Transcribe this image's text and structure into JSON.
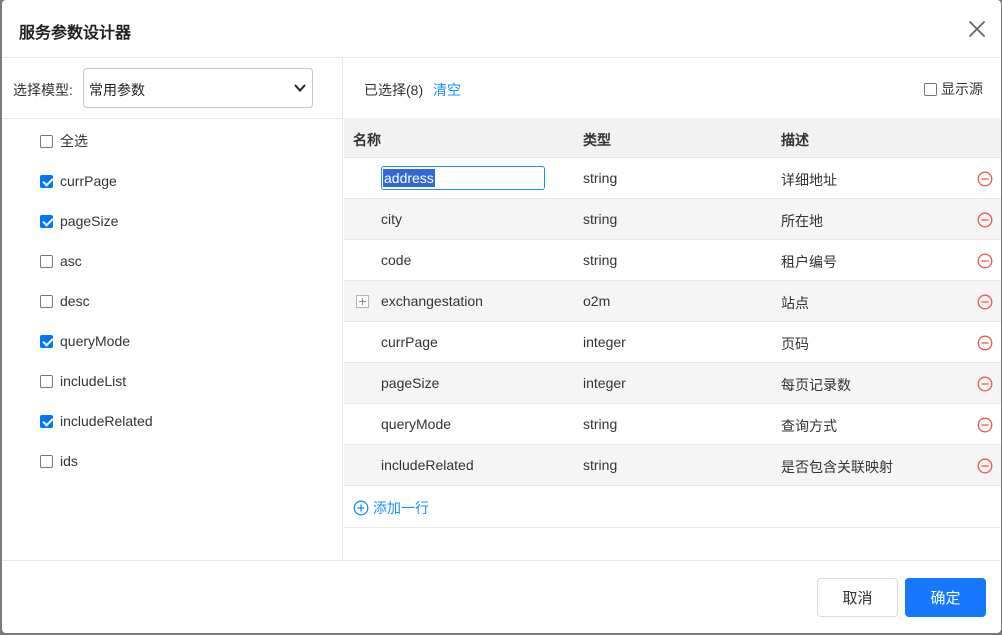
{
  "dialog": {
    "title": "服务参数设计器"
  },
  "left": {
    "model_label": "选择模型:",
    "model_value": "常用参数",
    "checkboxes": [
      {
        "label": "全选",
        "checked": false
      },
      {
        "label": "currPage",
        "checked": true
      },
      {
        "label": "pageSize",
        "checked": true
      },
      {
        "label": "asc",
        "checked": false
      },
      {
        "label": "desc",
        "checked": false
      },
      {
        "label": "queryMode",
        "checked": true
      },
      {
        "label": "includeList",
        "checked": false
      },
      {
        "label": "includeRelated",
        "checked": true
      },
      {
        "label": "ids",
        "checked": false
      }
    ]
  },
  "right": {
    "selected_text": "已选择(8)",
    "clear_label": "清空",
    "show_source_label": "显示源",
    "show_source_checked": false,
    "columns": [
      "名称",
      "类型",
      "描述"
    ],
    "rows": [
      {
        "name": "address",
        "type": "string",
        "desc": "详细地址"
      },
      {
        "name": "city",
        "type": "string",
        "desc": "所在地"
      },
      {
        "name": "code",
        "type": "string",
        "desc": "租户编号"
      },
      {
        "name": "exchangestation",
        "type": "o2m",
        "desc": "站点"
      },
      {
        "name": "currPage",
        "type": "integer",
        "desc": "页码"
      },
      {
        "name": "pageSize",
        "type": "integer",
        "desc": "每页记录数"
      },
      {
        "name": "queryMode",
        "type": "string",
        "desc": "查询方式"
      },
      {
        "name": "includeRelated",
        "type": "string",
        "desc": "是否包含关联映射"
      }
    ],
    "add_row_label": "添加一行"
  },
  "footer": {
    "cancel_label": "取消",
    "ok_label": "确定"
  },
  "colors": {
    "primary": "#1677ff",
    "link": "#1890ff",
    "danger": "#f0564c",
    "checkbox": "#0075ff"
  }
}
